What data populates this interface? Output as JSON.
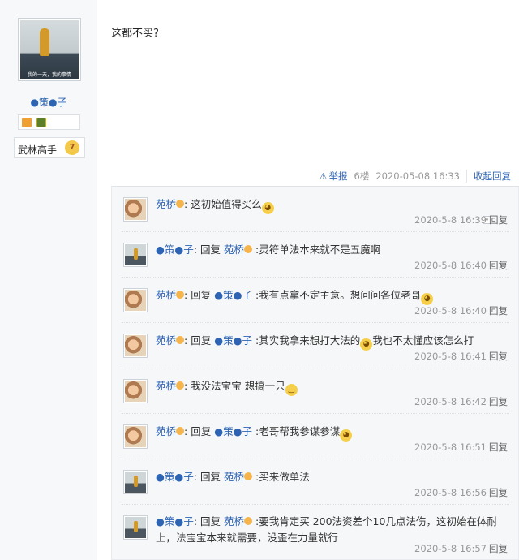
{
  "author": {
    "avatar_caption": "我的一天，我的事情",
    "name": "●策●子",
    "rank": "武林高手",
    "rank_level": "7"
  },
  "post": {
    "text": "这都不买?",
    "report_label": "举报",
    "floor": "6楼",
    "datetime": "2020-05-08 16:33",
    "toggle_label": "收起回复"
  },
  "replies": [
    {
      "user": "苑桥",
      "prefix": ":",
      "target": "",
      "text": " 这初始值得买么",
      "emoji": "grin",
      "date": "2020-5-8 16:39",
      "reply_label": "回复",
      "avatar": "yuanqiao"
    },
    {
      "user": "●策●子",
      "prefix": ": 回复 ",
      "target": "苑桥",
      "text": " :灵符单法本来就不是五魔啊",
      "emoji": "",
      "date": "2020-5-8 16:40",
      "reply_label": "回复",
      "avatar": "cezi"
    },
    {
      "user": "苑桥",
      "prefix": ": 回复 ",
      "target": "●策●子",
      "text": " :我有点拿不定主意。想问问各位老哥",
      "emoji": "grin",
      "date": "2020-5-8 16:40",
      "reply_label": "回复",
      "avatar": "yuanqiao"
    },
    {
      "user": "苑桥",
      "prefix": ": 回复 ",
      "target": "●策●子",
      "text": " :其实我拿来想打大法的",
      "text2": "我也不太懂应该怎么打",
      "emoji": "grin",
      "date": "2020-5-8 16:41",
      "reply_label": "回复",
      "avatar": "yuanqiao"
    },
    {
      "user": "苑桥",
      "prefix": ":",
      "target": "",
      "text": " 我没法宝宝 想搞一只",
      "emoji": "sweat",
      "date": "2020-5-8 16:42",
      "reply_label": "回复",
      "avatar": "yuanqiao"
    },
    {
      "user": "苑桥",
      "prefix": ": 回复 ",
      "target": "●策●子",
      "text": " :老哥帮我参谋参谋",
      "emoji": "grin",
      "date": "2020-5-8 16:51",
      "reply_label": "回复",
      "avatar": "yuanqiao"
    },
    {
      "user": "●策●子",
      "prefix": ": 回复 ",
      "target": "苑桥",
      "text": " :买来做单法",
      "emoji": "",
      "date": "2020-5-8 16:56",
      "reply_label": "回复",
      "avatar": "cezi"
    },
    {
      "user": "●策●子",
      "prefix": ": 回复 ",
      "target": "苑桥",
      "text": " :要我肯定买 200法资差个10几点法伤，这初始在体耐上，法宝宝本来就需要，没歪在力量就行",
      "emoji": "",
      "date": "2020-5-8 16:57",
      "reply_label": "回复",
      "avatar": "cezi"
    }
  ]
}
